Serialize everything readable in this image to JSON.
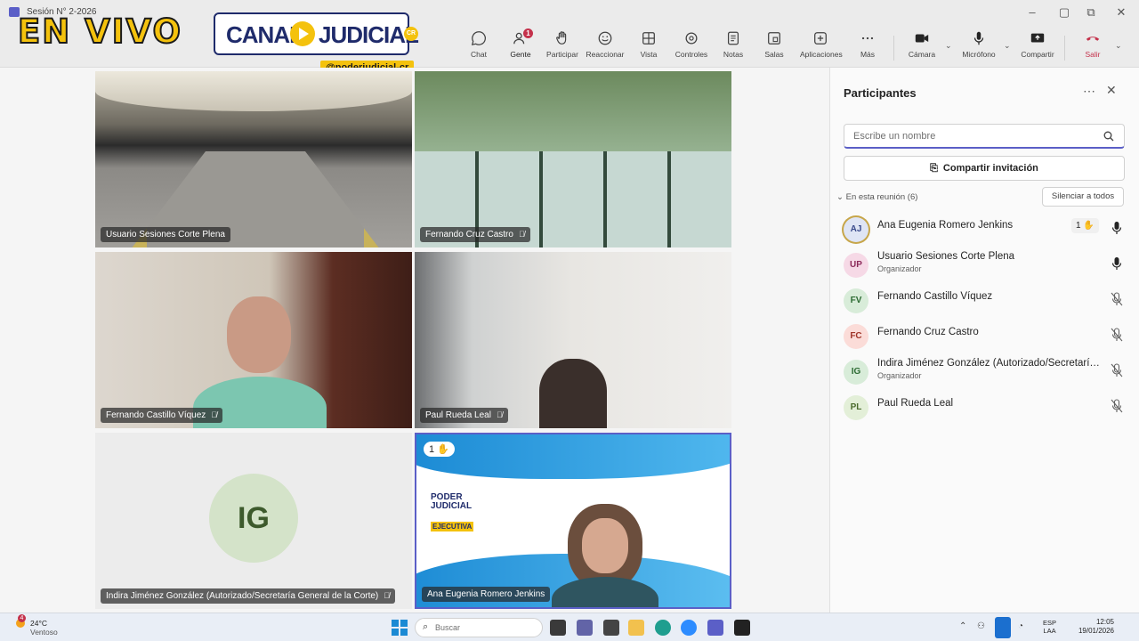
{
  "window": {
    "title": "Sesión N° 2-2026"
  },
  "overlay": {
    "live_text": "EN VIVO",
    "logo_left": "CANAL",
    "logo_right": "JUDICIAL",
    "logo_badge": "CR",
    "handle": "@poderjudicial-cr"
  },
  "toolbar": {
    "items": [
      {
        "label": "Chat",
        "icon": "chat-icon"
      },
      {
        "label": "Gente",
        "icon": "people-icon",
        "badge": "1",
        "active": true
      },
      {
        "label": "Participar",
        "icon": "raise-hand-icon"
      },
      {
        "label": "Reaccionar",
        "icon": "react-icon"
      },
      {
        "label": "Vista",
        "icon": "view-icon"
      },
      {
        "label": "Controles",
        "icon": "controls-icon"
      },
      {
        "label": "Notas",
        "icon": "notes-icon"
      },
      {
        "label": "Salas",
        "icon": "rooms-icon"
      },
      {
        "label": "Aplicaciones",
        "icon": "apps-icon"
      },
      {
        "label": "Más",
        "icon": "more-icon"
      },
      {
        "label": "Cámara",
        "icon": "camera-icon"
      },
      {
        "label": "Micrófono",
        "icon": "microphone-icon"
      },
      {
        "label": "Compartir",
        "icon": "share-icon"
      },
      {
        "label": "Salir",
        "icon": "leave-icon"
      }
    ]
  },
  "tiles": [
    {
      "name": "Usuario Sesiones Corte Plena",
      "muted": false
    },
    {
      "name": "Fernando Cruz Castro",
      "muted": true
    },
    {
      "name": "Fernando Castillo Víquez",
      "muted": true
    },
    {
      "name": "Paul Rueda Leal",
      "muted": true
    },
    {
      "name": "Indira Jiménez González (Autorizado/Secretaría General de la Corte)",
      "muted": true,
      "initials": "IG"
    },
    {
      "name": "Ana Eugenia Romero Jenkins",
      "muted": false,
      "hand": "1"
    }
  ],
  "slide": {
    "org_line1": "PODER",
    "org_line2": "JUDICIAL",
    "org_sub": "EJECUTIVA"
  },
  "panel": {
    "title": "Participantes",
    "search_placeholder": "Escribe un nombre",
    "invite_label": "Compartir invitación",
    "section_label": "En esta reunión (6)",
    "mute_all_label": "Silenciar a todos",
    "participants": [
      {
        "initials": "AJ",
        "name": "Ana Eugenia Romero Jenkins",
        "role": "",
        "hand": "1",
        "mic": "on",
        "avatar_bg": "#dfe5f5",
        "avatar_fg": "#3a4b8c"
      },
      {
        "initials": "UP",
        "name": "Usuario Sesiones Corte Plena",
        "role": "Organizador",
        "mic": "on",
        "avatar_bg": "#f6d9e6",
        "avatar_fg": "#8c2a5a"
      },
      {
        "initials": "FV",
        "name": "Fernando Castillo Víquez",
        "role": "",
        "mic": "off",
        "avatar_bg": "#d8ecd9",
        "avatar_fg": "#2d6b33"
      },
      {
        "initials": "FC",
        "name": "Fernando Cruz Castro",
        "role": "",
        "mic": "off",
        "avatar_bg": "#fbdcd8",
        "avatar_fg": "#a0362a"
      },
      {
        "initials": "IG",
        "name": "Indira Jiménez González (Autorizado/Secretaría...",
        "role": "Organizador",
        "mic": "off",
        "avatar_bg": "#d8ecd9",
        "avatar_fg": "#2d6b33"
      },
      {
        "initials": "PL",
        "name": "Paul Rueda Leal",
        "role": "",
        "mic": "off",
        "avatar_bg": "#e3efd8",
        "avatar_fg": "#4b6b2d"
      }
    ]
  },
  "taskbar": {
    "weather_temp": "24°C",
    "weather_desc": "Ventoso",
    "weather_badge": "4",
    "search_placeholder": "Buscar",
    "lang_line1": "ESP",
    "lang_line2": "LAA",
    "time": "12:05",
    "date": "19/01/2026"
  },
  "colors": {
    "accent": "#5b5fc7",
    "live_yellow": "#f4c20d",
    "leave_red": "#c4314b"
  }
}
